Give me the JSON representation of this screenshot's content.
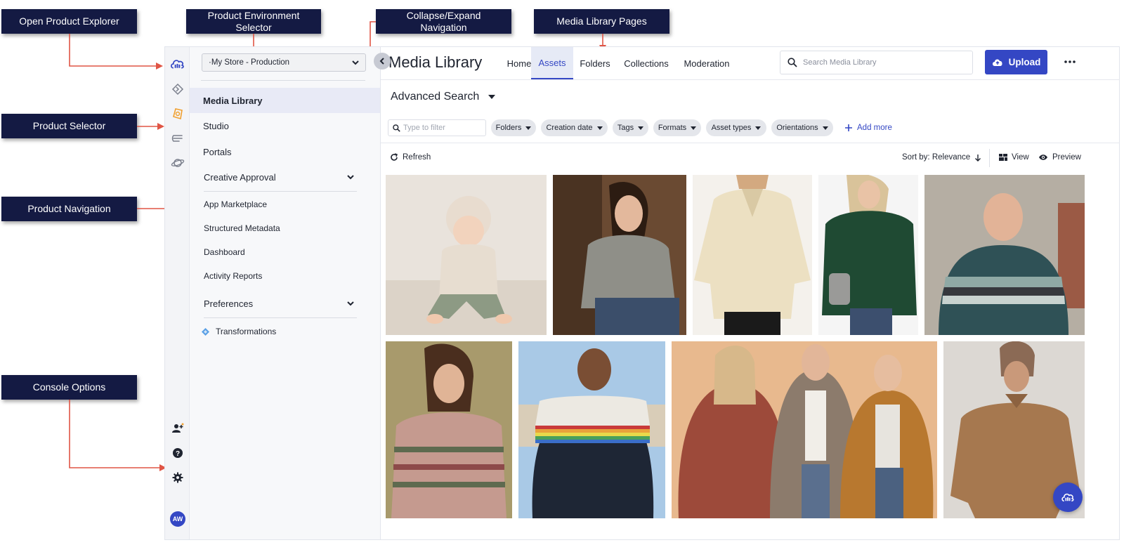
{
  "callouts": {
    "open_product_explorer": "Open Product Explorer",
    "product_env_selector": "Product Environment Selector",
    "collapse_expand": "Collapse/Expand Navigation",
    "media_library_pages": "Media Library Pages",
    "product_selector": "Product Selector",
    "product_navigation": "Product Navigation",
    "console_options": "Console Options"
  },
  "rail": {
    "icons": [
      "cloud-logo-icon",
      "code-diamond-icon",
      "media-library-icon",
      "stack-icon",
      "planet-icon"
    ],
    "bottom_icons": [
      "add-user-icon",
      "help-icon",
      "settings-icon"
    ],
    "avatar_initials": "AW"
  },
  "env_selector": {
    "value": "·My Store - Production"
  },
  "nav": {
    "items": [
      {
        "label": "Media Library"
      },
      {
        "label": "Studio"
      },
      {
        "label": "Portals"
      },
      {
        "label": "Creative Approval"
      },
      {
        "label": "App Marketplace"
      },
      {
        "label": "Structured Metadata"
      },
      {
        "label": "Dashboard"
      },
      {
        "label": "Activity Reports"
      },
      {
        "label": "Preferences"
      },
      {
        "label": "Transformations"
      }
    ]
  },
  "header": {
    "title": "Media Library",
    "tabs": [
      {
        "label": "Home"
      },
      {
        "label": "Assets"
      },
      {
        "label": "Folders"
      },
      {
        "label": "Collections"
      },
      {
        "label": "Moderation"
      }
    ],
    "active_tab": "Assets",
    "search_placeholder": "Search Media Library",
    "upload_label": "Upload"
  },
  "search_bar": {
    "advanced_label": "Advanced Search",
    "filter_placeholder": "Type to filter",
    "chips": [
      {
        "label": "Folders"
      },
      {
        "label": "Creation date"
      },
      {
        "label": "Tags"
      },
      {
        "label": "Formats"
      },
      {
        "label": "Asset types"
      },
      {
        "label": "Orientations"
      }
    ],
    "add_more": "Add more"
  },
  "toolbar": {
    "refresh": "Refresh",
    "sort": "Sort by: Relevance",
    "view": "View",
    "preview": "Preview"
  },
  "colors": {
    "accent": "#3447c4",
    "callout_bg": "#141a43",
    "arrow": "#e05545",
    "active_nav_bg": "#e8eaf6",
    "product_orange": "#f0a030"
  },
  "assets": [
    {
      "name": "baby-knit-photo"
    },
    {
      "name": "grey-sweater-photo"
    },
    {
      "name": "cream-sweater-photo"
    },
    {
      "name": "green-cable-knit-photo"
    },
    {
      "name": "striped-sweater-man-photo"
    },
    {
      "name": "fair-isle-sweater-photo"
    },
    {
      "name": "rainbow-stripe-sweater-photo"
    },
    {
      "name": "three-women-knits-photo"
    },
    {
      "name": "brown-sweater-photo"
    }
  ]
}
